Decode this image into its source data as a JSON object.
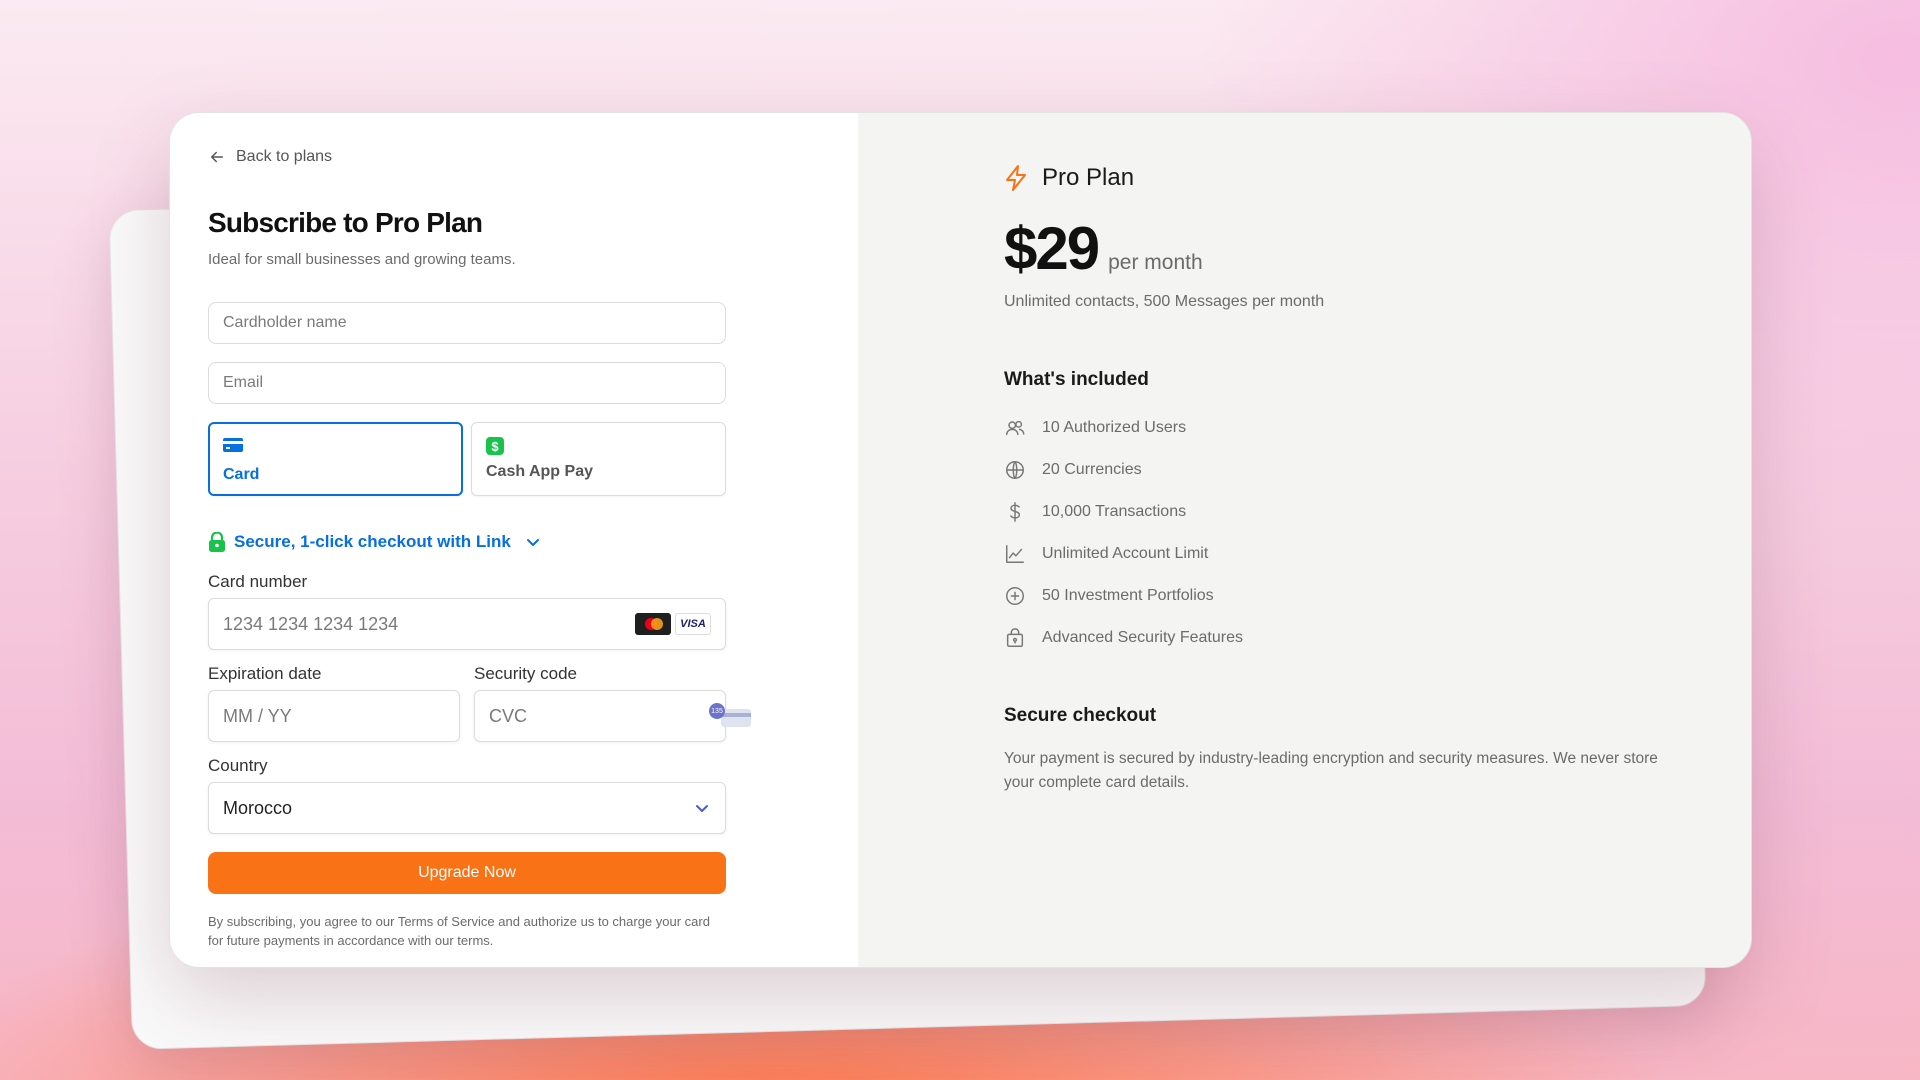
{
  "checkout": {
    "back_label": "Back to plans",
    "title": "Subscribe to Pro Plan",
    "subtitle": "Ideal for small businesses and growing teams.",
    "cardholder_placeholder": "Cardholder name",
    "email_placeholder": "Email",
    "payment_methods": [
      {
        "label": "Card",
        "selected": true,
        "icon": "credit-card-icon"
      },
      {
        "label": "Cash App Pay",
        "selected": false,
        "icon": "cash-app-icon"
      }
    ],
    "link_label": "Secure, 1-click checkout with Link",
    "card_number_label": "Card number",
    "card_number_placeholder": "1234 1234 1234 1234",
    "visa_text": "VISA",
    "expiration_label": "Expiration date",
    "expiration_placeholder": "MM / YY",
    "security_label": "Security code",
    "security_placeholder": "CVC",
    "cvc_badge": "135",
    "country_label": "Country",
    "country_value": "Morocco",
    "submit_label": "Upgrade Now",
    "terms": "By subscribing, you agree to our Terms of Service and authorize us to charge your card for future payments in accordance with our terms."
  },
  "plan": {
    "name": "Pro Plan",
    "price": "$29",
    "period": "per month",
    "description": "Unlimited contacts, 500 Messages per month",
    "included_heading": "What's included",
    "features": [
      {
        "label": "10 Authorized Users",
        "icon": "users-icon"
      },
      {
        "label": "20 Currencies",
        "icon": "globe-icon"
      },
      {
        "label": "10,000 Transactions",
        "icon": "dollar-icon"
      },
      {
        "label": "Unlimited Account Limit",
        "icon": "chart-line-icon"
      },
      {
        "label": "50 Investment Portfolios",
        "icon": "plus-circle-icon"
      },
      {
        "label": "Advanced Security Features",
        "icon": "lock-bag-icon"
      }
    ],
    "secure_heading": "Secure checkout",
    "secure_text": "Your payment is secured by industry-leading encryption and security measures. We never store your complete card details."
  },
  "colors": {
    "accent": "#f97316",
    "link_blue": "#0570de",
    "lock_green": "#19c34b"
  }
}
